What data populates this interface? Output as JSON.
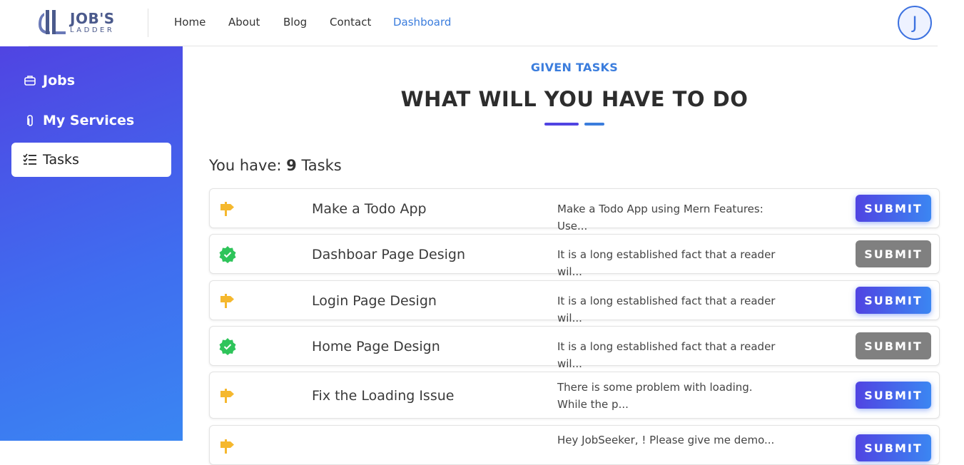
{
  "brand": {
    "name": "JOB'S",
    "sub": "LADDER"
  },
  "nav": [
    {
      "label": "Home",
      "active": false
    },
    {
      "label": "About",
      "active": false
    },
    {
      "label": "Blog",
      "active": false
    },
    {
      "label": "Contact",
      "active": false
    },
    {
      "label": "Dashboard",
      "active": true
    }
  ],
  "user": {
    "initial": "J"
  },
  "sidebar": {
    "items": [
      {
        "label": "Jobs",
        "icon": "briefcase-icon",
        "active": false
      },
      {
        "label": "My Services",
        "icon": "clipboard-icon",
        "active": false
      },
      {
        "label": "Tasks",
        "icon": "checklist-icon",
        "active": true
      }
    ]
  },
  "section": {
    "tag": "GIVEN TASKS",
    "title": "WHAT WILL YOU HAVE TO DO"
  },
  "summary": {
    "prefix": "You have: ",
    "count": "9",
    "suffix": " Tasks"
  },
  "tasks": [
    {
      "status": "pending",
      "status_icon": "signpost-icon",
      "title": "Make a Todo App",
      "description": "Make a Todo App using Mern Features: Use...",
      "button": "SUBMIT",
      "button_enabled": true
    },
    {
      "status": "done",
      "status_icon": "verified-check-icon",
      "title": "Dashboar Page Design",
      "description": "It is a long established fact that a reader wil...",
      "button": "SUBMIT",
      "button_enabled": false
    },
    {
      "status": "pending",
      "status_icon": "signpost-icon",
      "title": "Login Page Design",
      "description": "It is a long established fact that a reader wil...",
      "button": "SUBMIT",
      "button_enabled": true
    },
    {
      "status": "done",
      "status_icon": "verified-check-icon",
      "title": "Home Page Design",
      "description": "It is a long established fact that a reader wil...",
      "button": "SUBMIT",
      "button_enabled": false
    },
    {
      "status": "pending",
      "status_icon": "signpost-icon",
      "title": "Fix the Loading Issue",
      "description": "There is some problem with loading. While the p...",
      "button": "SUBMIT",
      "button_enabled": true
    },
    {
      "status": "pending",
      "status_icon": "signpost-icon",
      "title": "",
      "description": "Hey JobSeeker, ! Please give me demo...",
      "button": "SUBMIT",
      "button_enabled": true
    }
  ],
  "colors": {
    "accent": "#3b7ddd",
    "sidebar_start": "#5044e2",
    "sidebar_end": "#3a86f2",
    "pending": "#f5b82e",
    "done": "#2ec45a",
    "disabled": "#808080"
  }
}
